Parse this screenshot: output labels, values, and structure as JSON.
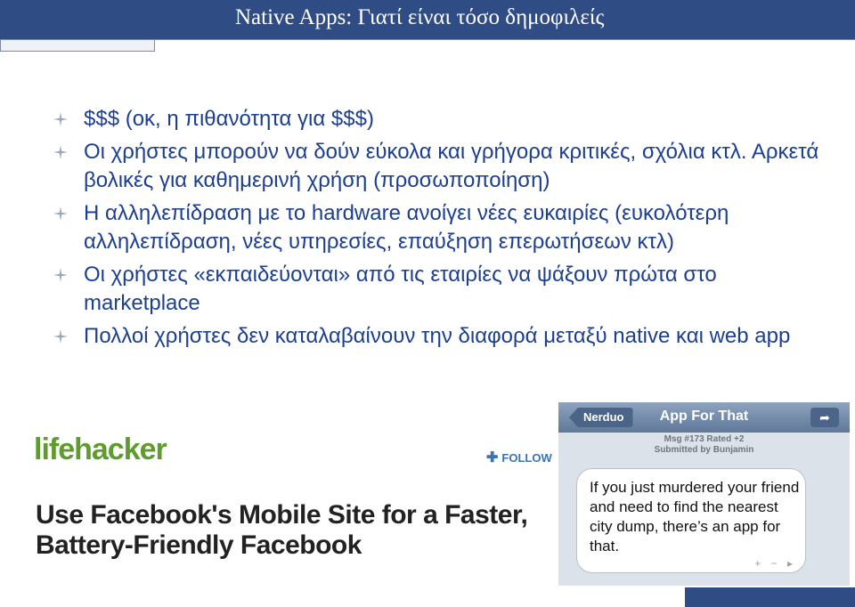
{
  "slide": {
    "title": "Native Apps: Γιατί είναι τόσο δημοφιλείς",
    "bullets": [
      "$$$ (οκ, η πιθανότητα για $$$)",
      "Οι χρήστες μπορούν να δούν εύκολα και γρήγορα κριτικές, σχόλια κτλ. Αρκετά βολικές για καθημερινή χρήση (προσωποποίηση)",
      "Η αλληλεπίδραση με το hardware ανοίγει νέες ευκαιρίες (ευκολότερη αλληλεπίδραση, νέες υπηρεσίες, επαύξηση επερωτήσεων κτλ)",
      "Οι χρήστες «εκπαιδεύονται» από τις εταιρίες να ψάξουν πρώτα στο marketplace",
      "Πολλοί χρήστες δεν καταλαβαίνουν την διαφορά μεταξύ native και web app"
    ],
    "bullet_icon": "sparkle-bullet-icon"
  },
  "lifehacker": {
    "logo": "lifehacker",
    "follow": "FOLLOW",
    "headline": "Use Facebook's Mobile Site for a Faster, Battery-Friendly Facebook"
  },
  "app_for_that": {
    "back_button": "Nerduo",
    "title": "App For That",
    "meta_line1": "Msg #173 Rated +2",
    "meta_line2": "Submitted by Bunjamin",
    "message": "If you just murdered your friend and need to find the nearest city dump, there’s an app for that.",
    "controls": "+ − ▸"
  },
  "colors": {
    "title_bar": "#2f4c85",
    "bullet_text": "#1c3f8f",
    "lifehacker_green": "#5f9c2e"
  }
}
